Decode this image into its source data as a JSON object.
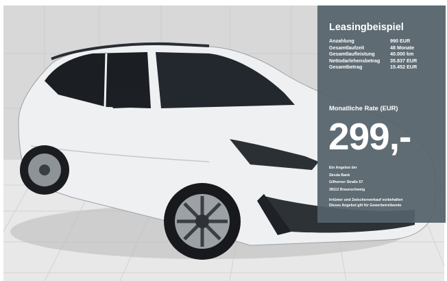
{
  "leasing": {
    "title": "Leasingbeispiel",
    "terms": [
      {
        "label": "Anzahlung",
        "value": "990 EUR"
      },
      {
        "label": "Gesamtlaufzeit",
        "value": "48 Monate"
      },
      {
        "label": "Gesamtlaufleistung",
        "value": "40.000 km"
      },
      {
        "label": "Nettodarlehensbetrag",
        "value": "35.837 EUR"
      },
      {
        "label": "Gesamtbetrag",
        "value": "15.452 EUR"
      }
    ],
    "rate_label": "Monatliche Rate (EUR)",
    "price": "299,-",
    "offer_lines": [
      "Ein Angebot der",
      "Skoda Bank",
      "Gifhorner Straße 57",
      "38112 Braunschweig"
    ],
    "disclaimer_lines": [
      "Irrtümer und Zwischenverkauf vorbehalten",
      "Dieses Angebot gilt für Gewerbetreibende"
    ]
  },
  "photo": {
    "subject": "white SUV on tiled showroom floor",
    "colors": {
      "wall": "#d7d7d7",
      "floor": "#e6e6e6",
      "car_body": "#eef0f2",
      "glass": "#1b1f24",
      "panel": "#54626a"
    }
  }
}
